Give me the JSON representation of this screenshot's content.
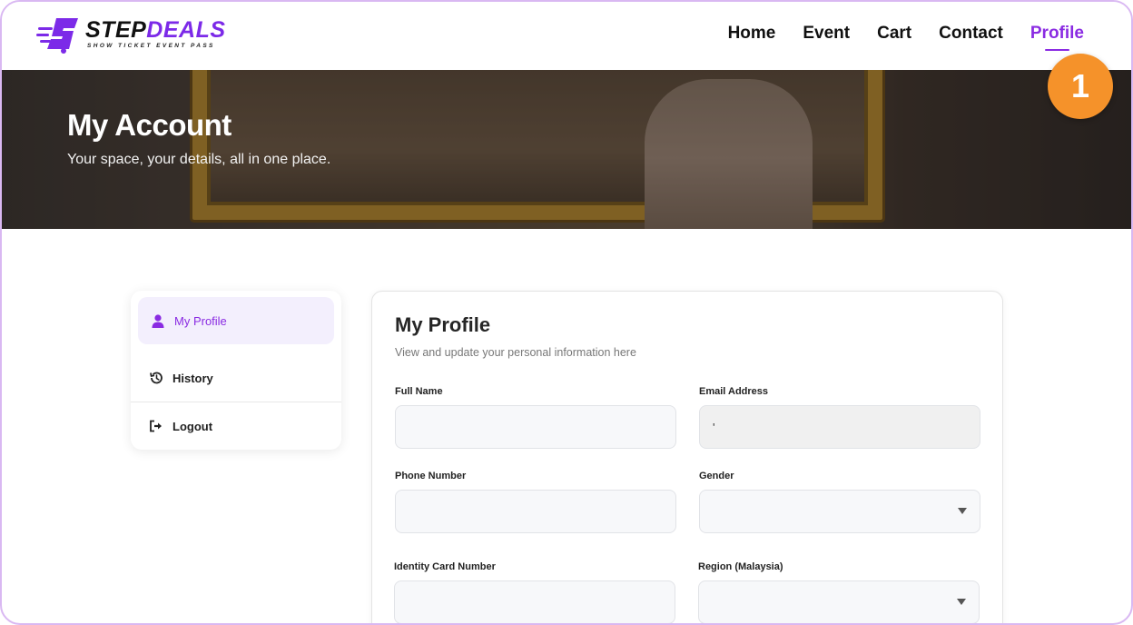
{
  "brand": {
    "logo_primary": "STEP",
    "logo_secondary": "DEALS",
    "tagline": "SHOW TICKET EVENT PASS",
    "accent_color": "#8a2be2",
    "logo_icon": "ticket-s-logo-icon"
  },
  "nav": {
    "items": [
      {
        "label": "Home",
        "active": false
      },
      {
        "label": "Event",
        "active": false
      },
      {
        "label": "Cart",
        "active": false
      },
      {
        "label": "Contact",
        "active": false
      },
      {
        "label": "Profile",
        "active": true
      }
    ]
  },
  "hero": {
    "title": "My Account",
    "subtitle": "Your space, your details, all in one place."
  },
  "badge": {
    "number": "1",
    "color": "#f5922a"
  },
  "sidebar": {
    "items": [
      {
        "label": "My Profile",
        "icon": "user-icon",
        "active": true
      },
      {
        "label": "History",
        "icon": "history-icon",
        "active": false
      },
      {
        "label": "Logout",
        "icon": "logout-icon",
        "active": false
      }
    ]
  },
  "profile": {
    "title": "My Profile",
    "subtitle": "View and update your personal information here",
    "fields": {
      "full_name": {
        "label": "Full Name",
        "value": ""
      },
      "email": {
        "label": "Email Address",
        "value": "'"
      },
      "phone": {
        "label": "Phone Number",
        "value": ""
      },
      "gender": {
        "label": "Gender",
        "value": ""
      },
      "ic_number": {
        "label": "Identity Card Number",
        "value": ""
      },
      "region": {
        "label": "Region (Malaysia)",
        "value": ""
      }
    }
  }
}
